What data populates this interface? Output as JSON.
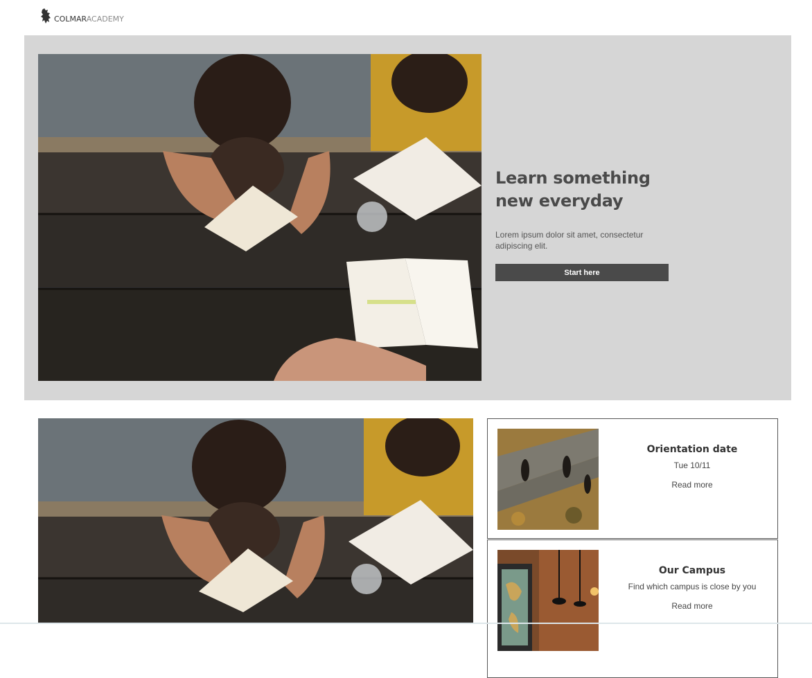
{
  "header": {
    "logo_part1": "COLMAR",
    "logo_part2": "ACADEMY",
    "logo_icon": "rampant-lion-icon"
  },
  "hero": {
    "title": "Learn something new everyday",
    "description": "Lorem ipsum dolor sit amet, consectetur adipiscing elit.",
    "button_label": "Start here",
    "image": "students-reading-at-picnic-table"
  },
  "cards": [
    {
      "title": "Orientation date",
      "subtitle": "Tue 10/11",
      "link": "Read more",
      "image": "people-walking-aerial"
    },
    {
      "title": "Our Campus",
      "subtitle": "Find which campus is close by you",
      "link": "Read more",
      "image": "cafe-interior-map"
    }
  ],
  "colors": {
    "hero_background": "#d6d6d6",
    "button_background": "#4a4a4a",
    "text_dark": "#4a4a4a"
  }
}
